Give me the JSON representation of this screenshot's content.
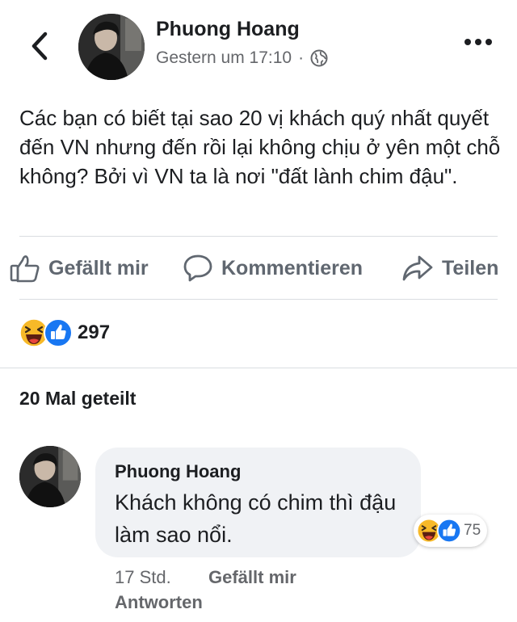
{
  "header": {
    "back_icon": "chevron-left-icon",
    "author": "Phuong Hoang",
    "timestamp": "Gestern um 17:10",
    "separator": "·",
    "privacy_icon": "globe-icon",
    "more_icon": "ellipsis-icon"
  },
  "post": {
    "text": "Các bạn có biết tại sao 20 vị khách quý nhất quyết đến VN nhưng đến rồi lại không chịu ở yên một chỗ không? Bởi vì VN ta là nơi \"đất lành chim đậu\"."
  },
  "actions": {
    "like_label": "Gefällt mir",
    "like_icon": "thumbs-up-outline-icon",
    "comment_label": "Kommentieren",
    "comment_icon": "speech-bubble-icon",
    "share_label": "Teilen",
    "share_icon": "share-arrow-icon"
  },
  "reactions": {
    "icons": [
      "haha-emoji-icon",
      "like-reaction-icon"
    ],
    "count": "297"
  },
  "shares": {
    "text": "20 Mal geteilt"
  },
  "comment": {
    "author": "Phuong Hoang",
    "text": "Khách không có chim thì đậu làm sao nổi.",
    "reaction_icons": [
      "haha-emoji-icon",
      "like-reaction-icon"
    ],
    "reaction_count": "75",
    "time": "17 Std.",
    "like_label": "Gefällt mir",
    "reply_label": "Antworten"
  },
  "colors": {
    "text": "#1c1e21",
    "secondary": "#65676b",
    "divider": "#dadde1",
    "bubble": "#f0f2f5",
    "like_blue": "#1877f2",
    "haha_yellow": "#f7b928"
  }
}
